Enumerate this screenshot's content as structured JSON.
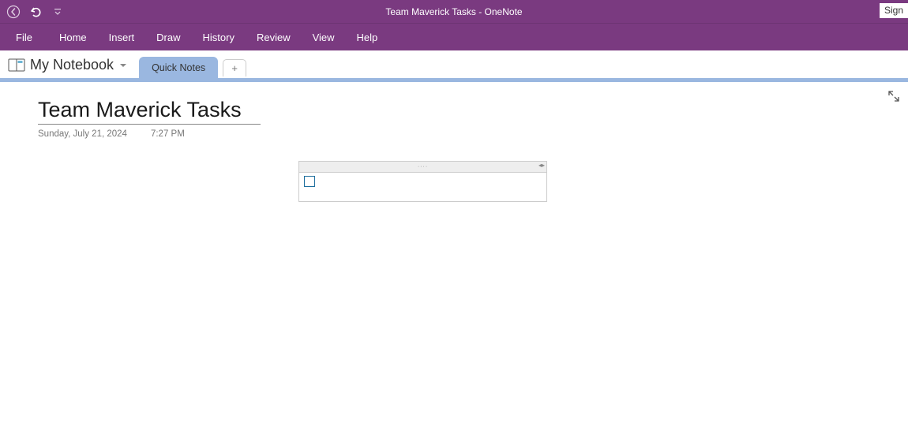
{
  "app": {
    "title_full": "Team Maverick Tasks  -  OneNote",
    "sign_in_label": "Sign"
  },
  "ribbon": {
    "tabs": [
      "File",
      "Home",
      "Insert",
      "Draw",
      "History",
      "Review",
      "View",
      "Help"
    ]
  },
  "notebook": {
    "name": "My Notebook"
  },
  "sections": {
    "active": "Quick Notes",
    "add_label": "+"
  },
  "page": {
    "title": "Team Maverick Tasks",
    "date": "Sunday, July 21, 2024",
    "time": "7:27 PM"
  },
  "icons": {
    "grip": "····",
    "resize_left": "◂",
    "resize_right": "▸"
  }
}
